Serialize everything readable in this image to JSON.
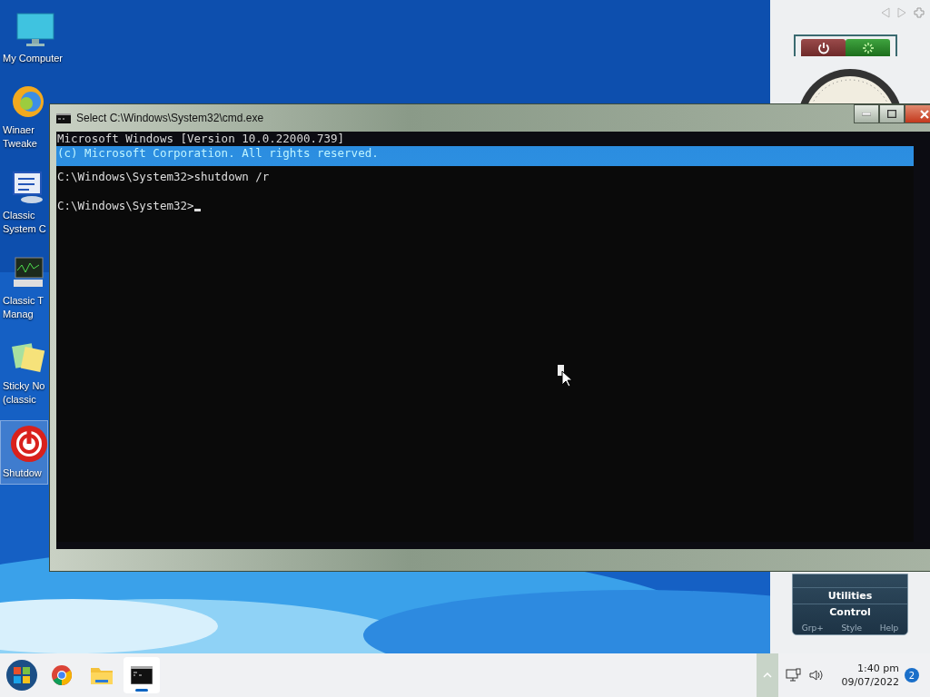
{
  "desktop_icons": [
    {
      "kind": "computer",
      "label_lines": [
        "My Computer"
      ]
    },
    {
      "kind": "tweaker",
      "label_lines": [
        "Winaer",
        "Tweake"
      ]
    },
    {
      "kind": "system",
      "label_lines": [
        "Classic",
        "System C"
      ]
    },
    {
      "kind": "taskmgr",
      "label_lines": [
        "Classic T",
        "Manag"
      ]
    },
    {
      "kind": "sticky",
      "label_lines": [
        "Sticky No",
        "(classic"
      ]
    },
    {
      "kind": "shutdown",
      "label_lines": [
        "Shutdow"
      ],
      "selected": true
    }
  ],
  "cmd_window": {
    "title": "Select C:\\Windows\\System32\\cmd.exe",
    "header_lines": [
      "Microsoft Windows [Version 10.0.22000.739]",
      "(c) Microsoft Corporation. All rights reserved."
    ],
    "prompt_lines": [
      "C:\\Windows\\System32>shutdown /r",
      "C:\\Windows\\System32>"
    ]
  },
  "gadget_panel": {
    "items": [
      "Utilities",
      "Control"
    ],
    "footer": [
      "Grp+",
      "Style",
      "Help"
    ]
  },
  "taskbar": {
    "apps": [
      {
        "kind": "start",
        "selected": false
      },
      {
        "kind": "chrome",
        "selected": false
      },
      {
        "kind": "explorer",
        "selected": false
      },
      {
        "kind": "cmd",
        "selected": true
      }
    ],
    "time": "1:40 pm",
    "date": "09/07/2022",
    "notification_count": "2"
  }
}
